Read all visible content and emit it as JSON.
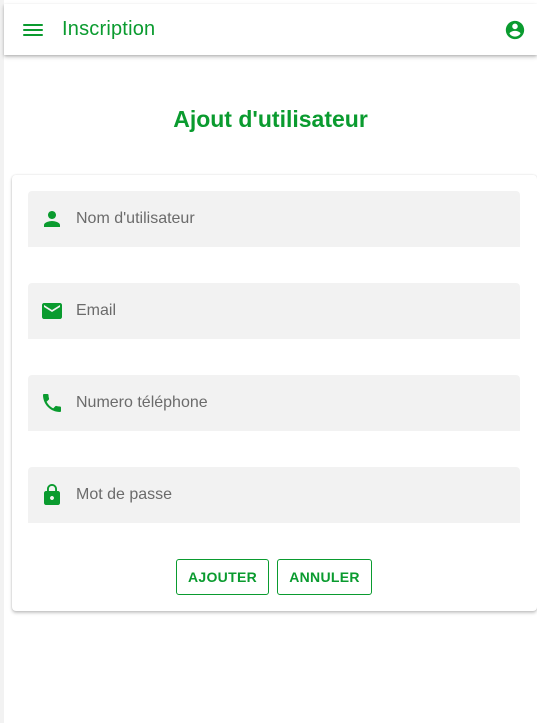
{
  "colors": {
    "primary": "#0a9b2f",
    "field_bg": "#f2f2f2",
    "placeholder": "#6b6b6b"
  },
  "toolbar": {
    "title": "Inscription",
    "menu_icon": "menu-icon",
    "account_icon": "account-circle-icon"
  },
  "page": {
    "title": "Ajout d'utilisateur"
  },
  "form": {
    "fields": [
      {
        "icon": "person-icon",
        "placeholder": "Nom d'utilisateur",
        "value": ""
      },
      {
        "icon": "email-icon",
        "placeholder": "Email",
        "value": ""
      },
      {
        "icon": "phone-icon",
        "placeholder": "Numero téléphone",
        "value": ""
      },
      {
        "icon": "lock-icon",
        "placeholder": "Mot de passe",
        "value": ""
      }
    ],
    "buttons": {
      "add_label": "AJOUTER",
      "cancel_label": "ANNULER"
    }
  }
}
